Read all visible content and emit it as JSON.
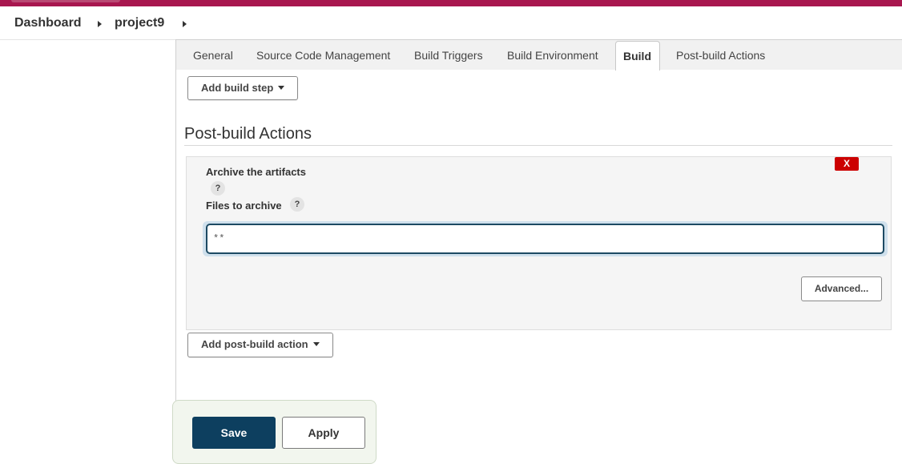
{
  "header": {
    "accent_color": "#a8174f"
  },
  "breadcrumb": {
    "items": [
      "Dashboard",
      "project9"
    ]
  },
  "tabs": {
    "items": [
      "General",
      "Source Code Management",
      "Build Triggers",
      "Build Environment",
      "Build",
      "Post-build Actions"
    ],
    "active": "Build"
  },
  "build": {
    "add_step_label": "Add build step"
  },
  "post_build": {
    "section_title": "Post-build Actions",
    "archive_panel": {
      "title": "Archive the artifacts",
      "delete_label": "X",
      "help_label": "?",
      "files_label": "Files to archive",
      "files_value": "**",
      "advanced_label": "Advanced..."
    },
    "add_action_label": "Add post-build action"
  },
  "footer": {
    "save_label": "Save",
    "apply_label": "Apply"
  },
  "icons": {
    "breadcrumb_separator": "chevron-right-icon",
    "dropdown": "caret-down-icon",
    "help": "help-icon",
    "delete": "close-icon"
  }
}
